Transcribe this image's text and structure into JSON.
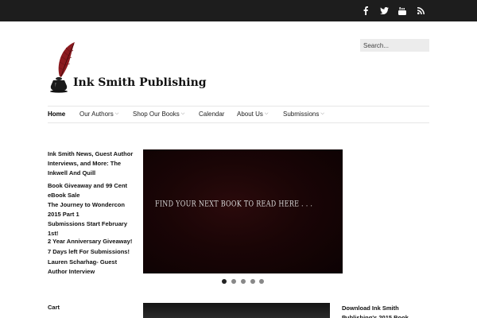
{
  "social": {
    "icons": [
      "facebook-icon",
      "twitter-icon",
      "youtube-icon",
      "rss-icon"
    ],
    "icon_color": "#ffffff",
    "bar_color": "#1d1d1d"
  },
  "brand": {
    "name": "Ink Smith Publishing",
    "logo_icon": "feather-quill-inkwell",
    "feather_color": "#8b1a1f"
  },
  "search": {
    "placeholder": "Search..."
  },
  "nav": {
    "items": [
      {
        "label": "Home",
        "active": true,
        "dropdown": false
      },
      {
        "label": "Our Authors",
        "active": false,
        "dropdown": true
      },
      {
        "label": "Shop Our Books",
        "active": false,
        "dropdown": true
      },
      {
        "label": "Calendar",
        "active": false,
        "dropdown": false
      },
      {
        "label": "About Us",
        "active": false,
        "dropdown": true
      },
      {
        "label": "Submissions",
        "active": false,
        "dropdown": true
      }
    ],
    "dropdown_glyph": "⌵"
  },
  "sidebar": {
    "title": "Ink Smith News, Guest Author Interviews, and More: The Inkwell And Quill",
    "posts": [
      "Book Giveaway and 99 Cent eBook Sale",
      "The Journey to Wondercon 2015 Part 1",
      "Submissions Start February 1st!",
      "2 Year Anniversary Giveaway!",
      "7 Days left For Submissions!",
      "Lauren Scharhag- Guest Author Interview"
    ]
  },
  "slider": {
    "caption": "FIND YOUR NEXT BOOK TO READ HERE . . .",
    "slide_count": 5,
    "active_slide": 1
  },
  "footer_widgets": {
    "cart_title": "Cart",
    "download_title": "Download Ink Smith Publishing's 2015 Book"
  }
}
